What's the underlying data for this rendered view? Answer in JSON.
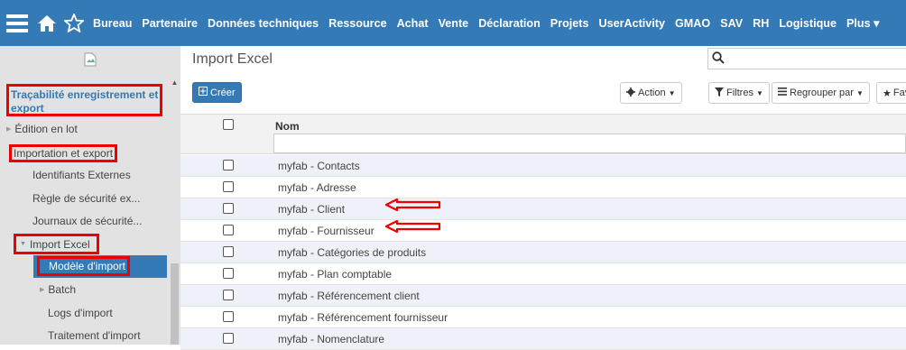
{
  "topbar": {
    "nav": [
      "Bureau",
      "Partenaire",
      "Données techniques",
      "Ressource",
      "Achat",
      "Vente",
      "Déclaration",
      "Projets",
      "UserActivity",
      "GMAO",
      "SAV",
      "RH",
      "Logistique",
      "Plus ▾"
    ]
  },
  "sidebar": {
    "heading": "Traçabilité enregistrement et export",
    "items": [
      {
        "label": "Édition en lot"
      },
      {
        "label": "Importation et export"
      },
      {
        "label": "Identifiants Externes"
      },
      {
        "label": "Règle de sécurité ex..."
      },
      {
        "label": "Journaux de sécurité..."
      },
      {
        "label": "Import Excel"
      },
      {
        "label": "Modèle d'import"
      },
      {
        "label": "Batch"
      },
      {
        "label": "Logs d'import"
      },
      {
        "label": "Traitement d'import"
      }
    ]
  },
  "main": {
    "title": "Import Excel",
    "search_placeholder": "",
    "create_label": "Créer",
    "action_label": "Action",
    "filters_label": "Filtres",
    "groupby_label": "Regrouper par",
    "favorites_label": "Fav"
  },
  "table": {
    "header_nom": "Nom",
    "rows": [
      "myfab - Contacts",
      "myfab - Adresse",
      "myfab - Client",
      "myfab - Fournisseur",
      "myfab - Catégories de produits",
      "myfab - Plan comptable",
      "myfab - Référencement client",
      "myfab - Référencement fournisseur",
      "myfab - Nomenclature"
    ]
  },
  "colors": {
    "primary": "#337ab7",
    "highlight": "#ee0000"
  }
}
